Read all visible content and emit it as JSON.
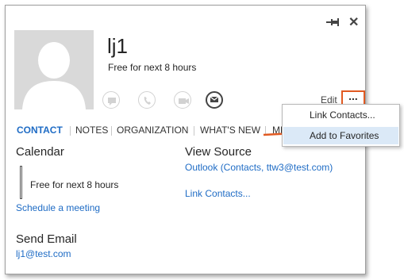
{
  "contact": {
    "name": "lj1",
    "status": "Free for next 8 hours"
  },
  "header": {
    "edit_label": "Edit",
    "more_label": "..."
  },
  "tabs": [
    "CONTACT",
    "NOTES",
    "ORGANIZATION",
    "WHAT'S NEW",
    "ME"
  ],
  "calendar": {
    "heading": "Calendar",
    "status": "Free for next 8 hours",
    "schedule_link": "Schedule a meeting"
  },
  "view_source": {
    "heading": "View Source",
    "source_link": "Outlook (Contacts, ttw3@test.com)",
    "link_contacts": "Link Contacts..."
  },
  "send_email": {
    "heading": "Send Email",
    "address": "lj1@test.com"
  },
  "context_menu": {
    "items": [
      "Link Contacts...",
      "Add to Favorites"
    ],
    "highlighted_index": 1
  },
  "colors": {
    "accent": "#1f6cc5",
    "callout": "#e15a22",
    "menu_highlight": "#dbe9f7"
  },
  "icons": [
    "pin-icon",
    "close-icon",
    "im-icon",
    "call-icon",
    "video-icon",
    "email-icon"
  ]
}
